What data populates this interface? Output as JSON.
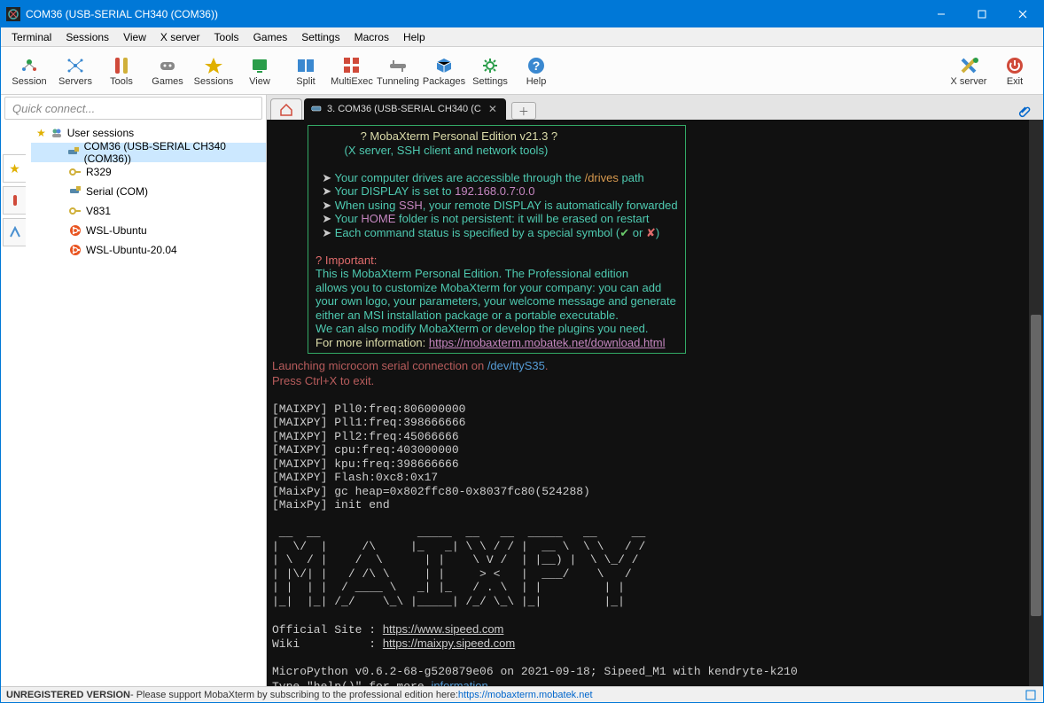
{
  "window": {
    "title": "COM36  (USB-SERIAL CH340 (COM36))"
  },
  "menu": [
    "Terminal",
    "Sessions",
    "View",
    "X server",
    "Tools",
    "Games",
    "Settings",
    "Macros",
    "Help"
  ],
  "toolbar": [
    {
      "name": "session-button",
      "label": "Session",
      "color": "#2a9d4a"
    },
    {
      "name": "servers-button",
      "label": "Servers",
      "color": "#3a88d0"
    },
    {
      "name": "tools-button",
      "label": "Tools",
      "color": "#d04a3a"
    },
    {
      "name": "games-button",
      "label": "Games",
      "color": "#888"
    },
    {
      "name": "sessions-button",
      "label": "Sessions",
      "color": "#e0b000"
    },
    {
      "name": "view-button",
      "label": "View",
      "color": "#2a9d4a"
    },
    {
      "name": "split-button",
      "label": "Split",
      "color": "#3a88d0"
    },
    {
      "name": "multiexec-button",
      "label": "MultiExec",
      "color": "#d04a3a"
    },
    {
      "name": "tunneling-button",
      "label": "Tunneling",
      "color": "#888"
    },
    {
      "name": "packages-button",
      "label": "Packages",
      "color": "#3a88d0"
    },
    {
      "name": "settings-button",
      "label": "Settings",
      "color": "#2a9d4a"
    },
    {
      "name": "help-button",
      "label": "Help",
      "color": "#3a88d0"
    }
  ],
  "toolbar_right": [
    {
      "name": "xserver-button",
      "label": "X server"
    },
    {
      "name": "exit-button",
      "label": "Exit"
    }
  ],
  "quick_placeholder": "Quick connect...",
  "tree": {
    "root": "User sessions",
    "items": [
      {
        "label": "COM36  (USB-SERIAL CH340 (COM36))",
        "icon": "serial",
        "sel": true
      },
      {
        "label": "R329",
        "icon": "key"
      },
      {
        "label": "Serial (COM)",
        "icon": "serial"
      },
      {
        "label": "V831",
        "icon": "key"
      },
      {
        "label": "WSL-Ubuntu",
        "icon": "ubuntu"
      },
      {
        "label": "WSL-Ubuntu-20.04",
        "icon": "ubuntu"
      }
    ]
  },
  "tab": {
    "label": "3. COM36  (USB-SERIAL CH340 (C"
  },
  "banner": {
    "title": "? MobaXterm Personal Edition v21.3 ?",
    "sub": "(X server, SSH client and network tools)",
    "b1a": "Your computer drives are accessible through the ",
    "b1b": "/drives",
    "b1c": " path",
    "b2a": "Your DISPLAY is set to ",
    "b2b": "192.168.0.7:0.0",
    "b3a": "When using ",
    "b3b": "SSH",
    "b3c": ", your remote DISPLAY is automatically forwarded",
    "b4a": "Your ",
    "b4b": "HOME",
    "b4c": " folder is not persistent: it will be erased on restart",
    "b5a": "Each command status is specified by a special symbol (",
    "b5b": "✔",
    "b5c": " or ",
    "b5d": "✘",
    "b5e": ")",
    "imp": "? Important:",
    "i1": "This is MobaXterm Personal Edition. The Professional edition",
    "i2": "allows you to customize MobaXterm for your company: you can add",
    "i3": "your own logo, your parameters, your welcome message and generate",
    "i4": "either an MSI installation package or a portable executable.",
    "i5": "We can also modify MobaXterm or develop the plugins you need.",
    "i6a": "For more information: ",
    "i6b": "https://mobaxterm.mobatek.net/download.html"
  },
  "conn": {
    "l1a": "Launching microcom serial connection on ",
    "l1b": "/dev/ttyS35",
    "l1c": ".",
    "l2": "Press Ctrl+X to exit."
  },
  "log": [
    "[MAIXPY] Pll0:freq:806000000",
    "[MAIXPY] Pll1:freq:398666666",
    "[MAIXPY] Pll2:freq:45066666",
    "[MAIXPY] cpu:freq:403000000",
    "[MAIXPY] kpu:freq:398666666",
    "[MAIXPY] Flash:0xc8:0x17",
    "[MaixPy] gc heap=0x802ffc80-0x8037fc80(524288)",
    "[MaixPy] init end"
  ],
  "ascii": [
    " __  __              _____  __   __  _____   __     __",
    "|  \\/  |     /\\     |_   _| \\ \\ / / |  __ \\  \\ \\   / /",
    "| \\  / |    /  \\      | |    \\ V /  | |__) |  \\ \\_/ /",
    "| |\\/| |   / /\\ \\     | |     > <   |  ___/    \\   /",
    "| |  | |  / ____ \\   _| |_   / . \\  | |         | |",
    "|_|  |_| /_/    \\_\\ |_____| /_/ \\_\\ |_|         |_|"
  ],
  "links": {
    "site_lbl": "Official Site : ",
    "site": "https://www.sipeed.com",
    "wiki_lbl": "Wiki          : ",
    "wiki": "https://maixpy.sipeed.com"
  },
  "mp": {
    "ver": "MicroPython v0.6.2-68-g520879e06 on 2021-09-18; Sipeed_M1 with kendryte-k210",
    "help_a": "Type \"help()\" for more ",
    "help_b": "information",
    "help_c": ".",
    "prompt": ">>> "
  },
  "status": {
    "bold": "UNREGISTERED VERSION",
    "text": "  -  Please support MobaXterm by subscribing to the professional edition here:  ",
    "link": "https://mobaxterm.mobatek.net"
  }
}
